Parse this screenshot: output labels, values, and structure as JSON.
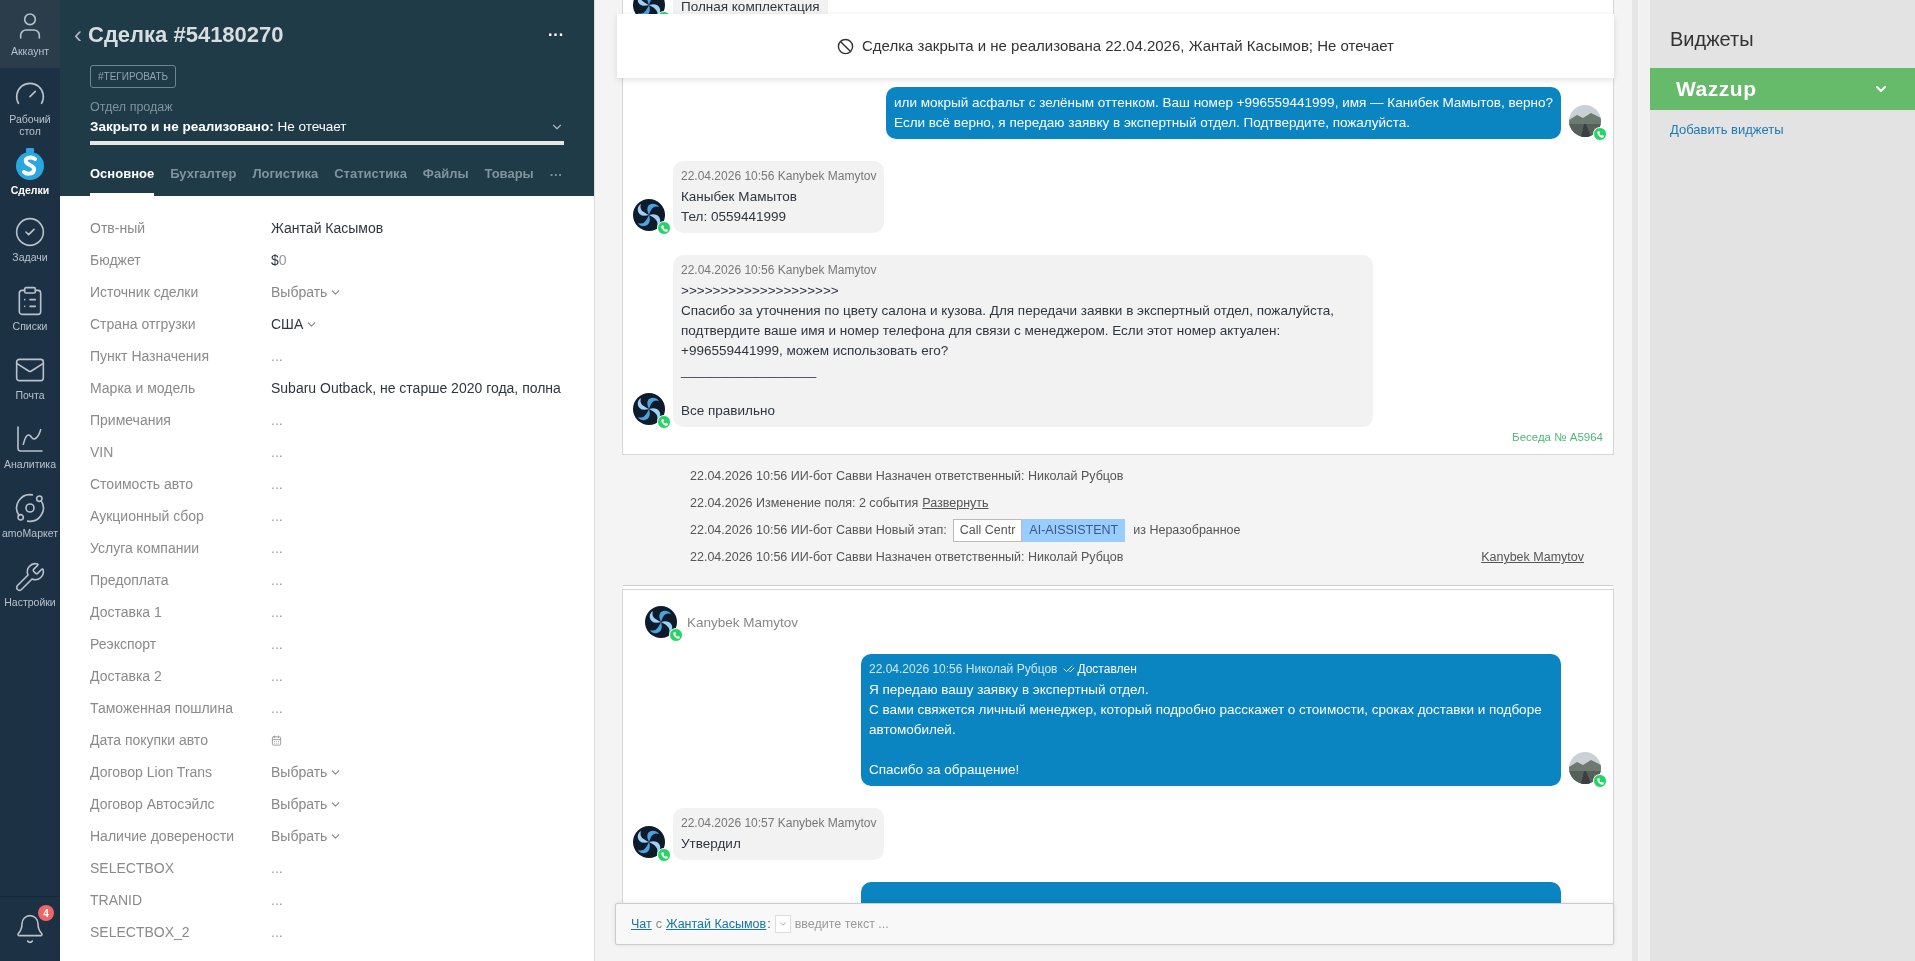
{
  "nav": {
    "items": [
      {
        "label": "Аккаунт",
        "selected": false
      },
      {
        "label": "Рабочий стол",
        "selected": false
      },
      {
        "label": "Сделки",
        "selected": true
      },
      {
        "label": "Задачи",
        "selected": false
      },
      {
        "label": "Списки",
        "selected": false
      },
      {
        "label": "Почта",
        "selected": false
      },
      {
        "label": "Аналитика",
        "selected": false
      },
      {
        "label": "amoМаркет",
        "selected": false
      },
      {
        "label": "Настройки",
        "selected": false
      }
    ],
    "notifications": {
      "count": "4"
    }
  },
  "deal": {
    "back": "‹",
    "title": "Сделка #54180270",
    "menu": "···",
    "tag_button": "#ТЕГИРОВАТЬ",
    "pipeline": "Отдел продаж",
    "status": "Закрыто и не реализовано:",
    "reason": "Не отечает",
    "tabs": [
      {
        "label": "Основное",
        "selected": true
      },
      {
        "label": "Бухгалтер",
        "selected": false
      },
      {
        "label": "Логистика",
        "selected": false
      },
      {
        "label": "Статистика",
        "selected": false
      },
      {
        "label": "Файлы",
        "selected": false
      },
      {
        "label": "Товары",
        "selected": false
      }
    ],
    "more_tabs": "···",
    "fields": [
      {
        "label": "Отв-ный",
        "kind": "text",
        "value": "Жантай Касымов"
      },
      {
        "label": "Бюджет",
        "kind": "money",
        "currency": "$",
        "value": "0"
      },
      {
        "label": "Источник сделки",
        "kind": "select",
        "placeholder": "Выбрать"
      },
      {
        "label": "Страна отгрузки",
        "kind": "select_set",
        "value": "США"
      },
      {
        "label": "Пункт Назначения",
        "kind": "empty",
        "value": "..."
      },
      {
        "label": "Марка и модель",
        "kind": "text",
        "value": "Subaru Outback, не старше 2020 года, полна"
      },
      {
        "label": "Примечания",
        "kind": "empty",
        "value": "..."
      },
      {
        "label": "VIN",
        "kind": "empty",
        "value": "..."
      },
      {
        "label": "Стоимость авто",
        "kind": "empty",
        "value": "..."
      },
      {
        "label": "Аукционный сбор",
        "kind": "empty",
        "value": "..."
      },
      {
        "label": "Услуга компании",
        "kind": "empty",
        "value": "..."
      },
      {
        "label": "Предоплата",
        "kind": "empty",
        "value": "..."
      },
      {
        "label": "Доставка 1",
        "kind": "empty",
        "value": "..."
      },
      {
        "label": "Реэкспорт",
        "kind": "empty",
        "value": "..."
      },
      {
        "label": "Доставка 2",
        "kind": "empty",
        "value": "..."
      },
      {
        "label": "Таможенная пошлина",
        "kind": "empty",
        "value": "..."
      },
      {
        "label": "Дата покупки авто",
        "kind": "date"
      },
      {
        "label": "Договор Lion Trans",
        "kind": "select",
        "placeholder": "Выбрать"
      },
      {
        "label": "Договор Автосэйлс",
        "kind": "select",
        "placeholder": "Выбрать"
      },
      {
        "label": "Наличие доверености",
        "kind": "select",
        "placeholder": "Выбрать"
      },
      {
        "label": "SELECTBOX",
        "kind": "empty",
        "value": "..."
      },
      {
        "label": "TRANID",
        "kind": "empty",
        "value": "..."
      },
      {
        "label": "SELECTBOX_2",
        "kind": "empty",
        "value": "..."
      }
    ]
  },
  "banner": {
    "text": "Сделка закрыта и не реализована 22.04.2026, Жантай Касымов; Не отечает"
  },
  "conversation": {
    "messages": [
      {
        "kind": "in",
        "text": "Полная комплектация"
      },
      {
        "kind": "out",
        "text": "или мокрый асфальт с зелёным оттенком. Ваш номер +996559441999, имя — Канибек Мамытов, верно?\nЕсли всё верно, я передаю заявку в экспертный отдел. Подтвердите, пожалуйста."
      },
      {
        "kind": "in",
        "meta": "22.04.2026 10:56 Kanybek Mamytov",
        "text": "Каныбек Мамытов\nТел: 0559441999"
      },
      {
        "kind": "in",
        "meta": "22.04.2026 10:56 Kanybek Mamytov",
        "text": ">>>>>>>>>>>>>>>>>>>>\nСпасибо за уточнения по цвету салона и кузова. Для передачи заявки в экспертный отдел, пожалуйста, подтвердите ваше имя и номер телефона для связи с менеджером. Если этот номер актуален: +996559441999, можем использовать его?\n__________________\n\nВсе правильно"
      }
    ],
    "footer": "Беседа № А5964"
  },
  "events": [
    {
      "kind": "note",
      "text": "22.04.2026 10:56 ИИ-бот Савви Назначен ответственный: Николай Рубцов"
    },
    {
      "kind": "expand",
      "text": "22.04.2026 Изменение поля: 2 события",
      "link": "Развернуть"
    },
    {
      "kind": "stage",
      "text": "22.04.2026 10:56 ИИ-бот Савви Новый этап:",
      "stages": [
        {
          "label": "Call Centr",
          "selected": false
        },
        {
          "label": "AI-AISSISTENT",
          "selected": true
        }
      ],
      "after": "из Неразобранное"
    },
    {
      "kind": "note",
      "text": "22.04.2026 10:56 ИИ-бот Савви Назначен ответственный: Николай Рубцов",
      "author": "Kanybek Mamytov"
    }
  ],
  "chat": {
    "contact": "Kanybek Mamytov",
    "messages": [
      {
        "kind": "out",
        "meta": "22.04.2026 10:56 Николай Рубцов",
        "status": "Доставлен",
        "text": "Я передаю вашу заявку в экспертный отдел.\nС вами свяжется личный менеджер, который подробно расскажет о стоимости, сроках доставки и подборе автомобилей.\n\nСпасибо за обращение!"
      },
      {
        "kind": "in",
        "meta": "22.04.2026 10:57 Kanybek Mamytov",
        "text": "Утвердил"
      },
      {
        "kind": "out_cut"
      }
    ]
  },
  "composer": {
    "mode": "Чат",
    "preposition": "с",
    "recipient": "Жантай Касымов",
    "separator": ":",
    "placeholder": "введите текст ..."
  },
  "widgets": {
    "title": "Виджеты",
    "items": [
      {
        "label": "Wazzup",
        "expanded": false
      }
    ],
    "add_link": "Добавить виджеты"
  }
}
